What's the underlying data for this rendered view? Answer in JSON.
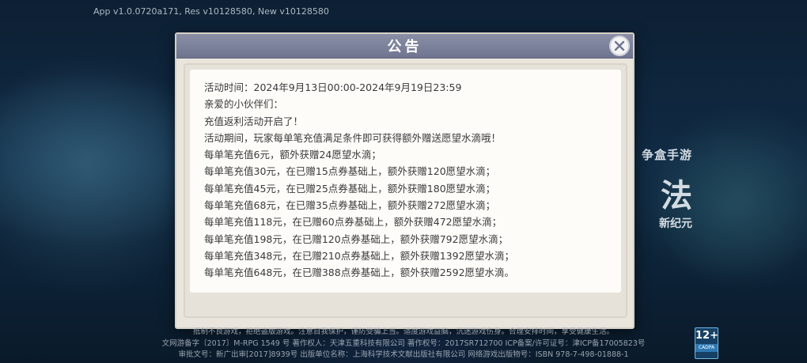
{
  "version_info": "App v1.0.0720a171, Res v10128580, New v10128580",
  "background": {
    "logo_small": "争盒手游",
    "logo_big": "法",
    "logo_sub": "新纪元"
  },
  "dialog": {
    "title": "公告",
    "close_icon": "close-x-icon",
    "lines": [
      "活动时间：2024年9月13日00:00-2024年9月19日23:59",
      "亲爱的小伙伴们：",
      "充值返利活动开启了！",
      "活动期间，玩家每单笔充值满足条件即可获得额外赠送愿望水滴哦！",
      "每单笔充值6元，额外获赠24愿望水滴；",
      "每单笔充值30元，在已赠15点券基础上，额外获赠120愿望水滴；",
      "每单笔充值45元，在已赠25点券基础上，额外获赠180愿望水滴；",
      "每单笔充值68元，在已赠35点券基础上，额外获赠272愿望水滴；",
      "每单笔充值118元，在已赠60点券基础上，额外获赠472愿望水滴；",
      "每单笔充值198元，在已赠120点券基础上，额外获赠792愿望水滴；",
      "每单笔充值348元，在已赠210点券基础上，额外获赠1392愿望水滴；",
      "每单笔充值648元，在已赠388点券基础上，额外获赠2592愿望水滴。"
    ]
  },
  "footer": {
    "line1": "抵制不良游戏，拒绝盗版游戏。注意自我保护，谨防受骗上当。适度游戏益脑，沉迷游戏伤身。合理安排时间，享受健康生活。",
    "line2": "文网游备字〔2017〕M-RPG 1549 号 著作权人：天津五重科技有限公司 著作权号：2017SR712700 ICP备案/许可证号：津ICP备17005823号",
    "line3": "审批文号：新广出审[2017]8939号 出版单位名称：上海科学技术文献出版社有限公司 网络游戏出版物号：ISBN 978-7-498-01888-1",
    "age_rating": "12+",
    "age_label": "CADPA"
  },
  "colors": {
    "header_bg": "#7b8099",
    "content_bg": "#fdfcf8",
    "text": "#3a3a3a"
  }
}
